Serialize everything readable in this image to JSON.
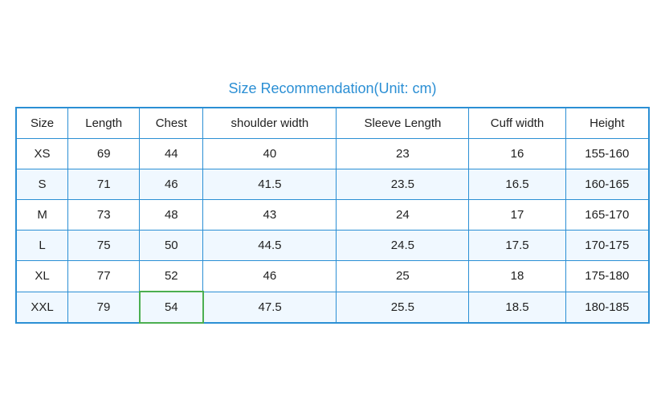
{
  "title": "Size Recommendation(Unit: cm)",
  "columns": [
    "Size",
    "Length",
    "Chest",
    "shoulder width",
    "Sleeve Length",
    "Cuff width",
    "Height"
  ],
  "rows": [
    [
      "XS",
      "69",
      "44",
      "40",
      "23",
      "16",
      "155-160"
    ],
    [
      "S",
      "71",
      "46",
      "41.5",
      "23.5",
      "16.5",
      "160-165"
    ],
    [
      "M",
      "73",
      "48",
      "43",
      "24",
      "17",
      "165-170"
    ],
    [
      "L",
      "75",
      "50",
      "44.5",
      "24.5",
      "17.5",
      "170-175"
    ],
    [
      "XL",
      "77",
      "52",
      "46",
      "25",
      "18",
      "175-180"
    ],
    [
      "XXL",
      "79",
      "54",
      "47.5",
      "25.5",
      "18.5",
      "180-185"
    ]
  ],
  "highlighted": {
    "row": 5,
    "col": 2
  }
}
